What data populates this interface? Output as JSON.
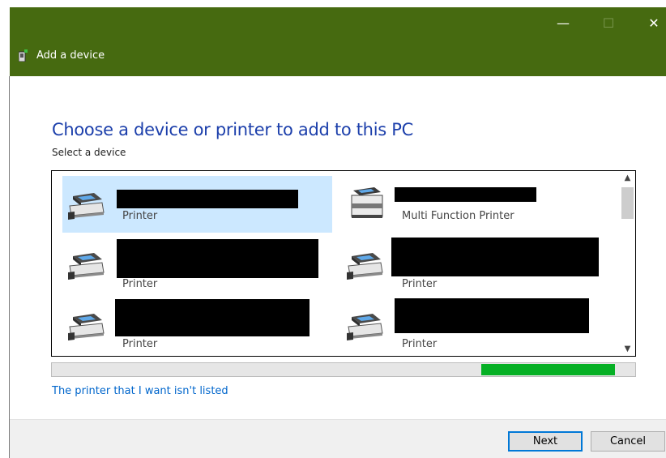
{
  "window": {
    "title": "Add a device",
    "minimize_glyph": "—",
    "maximize_glyph": "☐",
    "close_glyph": "✕",
    "title_bar_color": "#466a10"
  },
  "main": {
    "heading": "Choose a device or printer to add to this PC",
    "sublabel": "Select a device"
  },
  "devices": [
    {
      "type": "Printer",
      "name": "[redacted]",
      "icon": "printer-icon",
      "selected": true
    },
    {
      "type": "Multi Function Printer",
      "name": "[redacted]",
      "icon": "multifunction-printer-icon",
      "selected": false
    },
    {
      "type": "Printer",
      "name": "[redacted]",
      "icon": "printer-icon",
      "selected": false
    },
    {
      "type": "Printer",
      "name": "[redacted]",
      "icon": "printer-icon",
      "selected": false
    },
    {
      "type": "Printer",
      "name": "[redacted]",
      "icon": "printer-icon",
      "selected": false
    },
    {
      "type": "Printer",
      "name": "[redacted]",
      "icon": "printer-icon",
      "selected": false
    }
  ],
  "scrollbar": {
    "up_glyph": "▲",
    "down_glyph": "▼"
  },
  "search_progress": {
    "state": "indeterminate-marquee",
    "color": "#06b025"
  },
  "link": {
    "label": "The printer that I want isn't listed"
  },
  "footer": {
    "next_label": "Next",
    "cancel_label": "Cancel"
  }
}
